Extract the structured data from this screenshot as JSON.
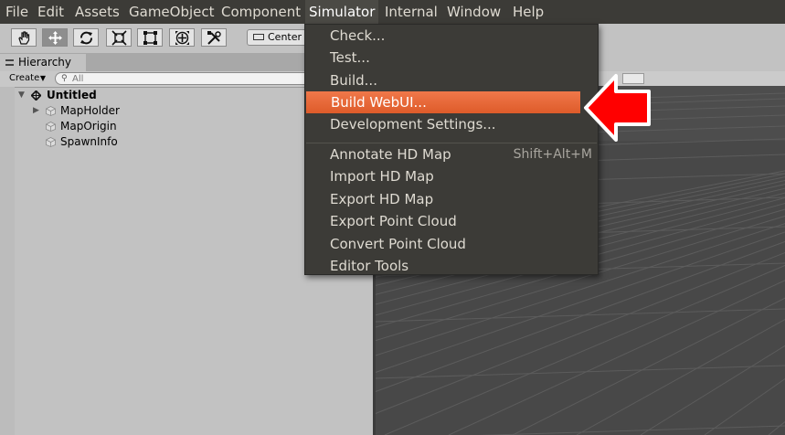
{
  "menubar": {
    "items": [
      "File",
      "Edit",
      "Assets",
      "GameObject",
      "Component",
      "Simulator",
      "Internal",
      "Window",
      "Help"
    ],
    "active": "Simulator"
  },
  "toolbar": {
    "tools": [
      {
        "name": "hand-tool",
        "icon": "hand-icon"
      },
      {
        "name": "move-tool",
        "icon": "move-arrows-icon",
        "selected": true
      },
      {
        "name": "rotate-tool",
        "icon": "rotate-icon"
      },
      {
        "name": "scale-tool",
        "icon": "scale-icon"
      },
      {
        "name": "rect-tool",
        "icon": "rect-transform-icon"
      },
      {
        "name": "transform-tool",
        "icon": "transform-icon"
      },
      {
        "name": "custom-tool",
        "icon": "tools-icon"
      }
    ],
    "pivot_label": "Center"
  },
  "hierarchy": {
    "tab_label": "Hierarchy",
    "create_label": "Create",
    "search_placeholder": "All",
    "scene_name": "Untitled",
    "objects": [
      "MapHolder",
      "MapOrigin",
      "SpawnInfo"
    ]
  },
  "dropdown": {
    "items": [
      {
        "label": "Check..."
      },
      {
        "label": "Test..."
      },
      {
        "label": "Build..."
      },
      {
        "label": "Build WebUI...",
        "highlighted": true
      },
      {
        "label": "Development Settings..."
      },
      {
        "label": "Annotate HD Map",
        "shortcut": "Shift+Alt+M"
      },
      {
        "label": "Import HD Map"
      },
      {
        "label": "Export HD Map"
      },
      {
        "label": "Export Point Cloud"
      },
      {
        "label": "Convert Point Cloud"
      },
      {
        "label": "Editor Tools"
      }
    ]
  },
  "colors": {
    "highlight": "#e9643a",
    "menubar": "#3c3b37",
    "callout_arrow": "#ff0000"
  }
}
